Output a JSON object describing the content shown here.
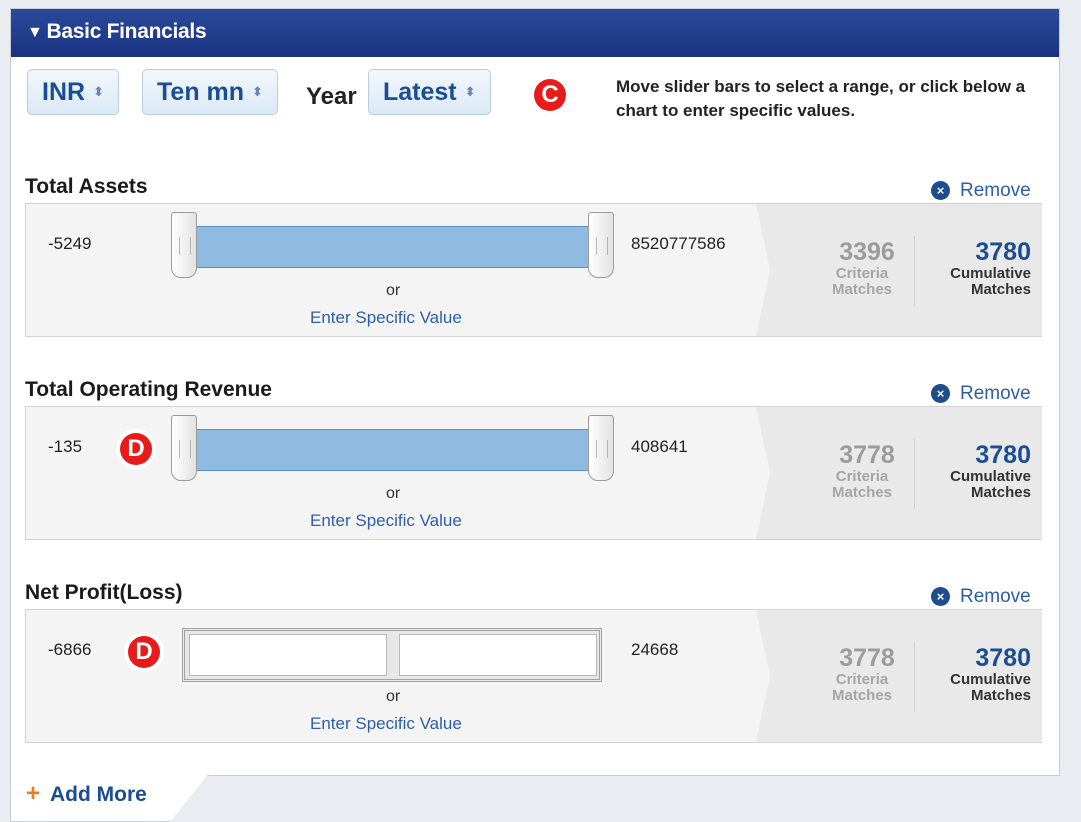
{
  "header": {
    "arrow": "▼",
    "title": "Basic Financials"
  },
  "toolbar": {
    "currency": "INR",
    "units": "Ten mn",
    "year_label": "Year",
    "year": "Latest",
    "select_arrows": "⬍",
    "marker_c": "C",
    "instructions": "Move slider bars to select a range, or click below a chart to enter specific values."
  },
  "common": {
    "remove_label": "Remove",
    "remove_icon": "×",
    "or": "or",
    "enter_value": "Enter Specific Value",
    "criteria_label": "Criteria Matches",
    "cumulative_label": "Cumulative Matches",
    "marker_d": "D"
  },
  "sections": [
    {
      "title": "Total Assets",
      "min": "-5249",
      "max": "8520777586",
      "criteria": "3396",
      "cumulative": "3780"
    },
    {
      "title": "Total Operating Revenue",
      "min": "-135",
      "max": "408641",
      "criteria": "3778",
      "cumulative": "3780"
    },
    {
      "title": "Net Profit(Loss)",
      "min": "-6866",
      "max": "24668",
      "criteria": "3778",
      "cumulative": "3780"
    }
  ],
  "footer": {
    "plus": "+",
    "add_more": "Add More"
  }
}
